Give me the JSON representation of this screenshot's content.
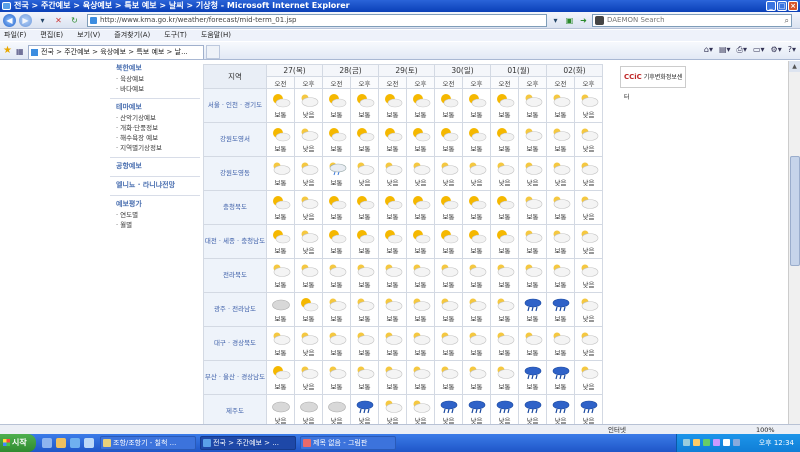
{
  "window": {
    "title": "전국 > 주간예보 > 육상예보 > 특보 예보 > 날씨 > 기상청 - Microsoft Internet Explorer"
  },
  "address": {
    "url": "http://www.kma.go.kr/weather/forecast/mid-term_01.jsp",
    "search_placeholder": "DAEMON Search"
  },
  "menu": [
    "파일(F)",
    "편집(E)",
    "보기(V)",
    "즐겨찾기(A)",
    "도구(T)",
    "도움말(H)"
  ],
  "tab": {
    "label": "전국 > 주간예보 > 육상예보 > 특보 예보 > 날..."
  },
  "sidebar": {
    "sections": [
      {
        "heading": "북한예보",
        "items": [
          "· 육상예보",
          "· 바다예보"
        ]
      },
      {
        "heading": "테마예보",
        "items": [
          "· 산악기상예보",
          "· 개화·단풍정보",
          "· 해수욕장 예보",
          "· 지역별기상정보"
        ]
      },
      {
        "heading": "공항예보",
        "items": []
      },
      {
        "heading": "엘니뇨 · 라니냐전망",
        "items": []
      },
      {
        "heading": "예보평가",
        "items": [
          "· 연도별",
          "· 월별"
        ]
      }
    ]
  },
  "forecast": {
    "region_header": "지역",
    "dates": [
      "27(목)",
      "28(금)",
      "29(토)",
      "30(일)",
      "01(월)",
      "02(화)"
    ],
    "am": "오전",
    "pm": "오후",
    "rows": [
      {
        "region": "서울 · 인천 · 경기도",
        "cells": [
          [
            "sun-cloud",
            "보통"
          ],
          [
            "cloud",
            "낮음"
          ],
          [
            "sun-cloud",
            "보통"
          ],
          [
            "sun-cloud",
            "보통"
          ],
          [
            "sun-cloud",
            "보통"
          ],
          [
            "sun-cloud",
            "보통"
          ],
          [
            "sun-cloud",
            "보통"
          ],
          [
            "sun-cloud",
            "보통"
          ],
          [
            "sun-cloud",
            "보통"
          ],
          [
            "cloud",
            "보통"
          ],
          [
            "cloud",
            "보통"
          ],
          [
            "cloud",
            "낮음"
          ]
        ]
      },
      {
        "region": "강원도영서",
        "cells": [
          [
            "sun-cloud",
            "보통"
          ],
          [
            "cloud",
            "낮음"
          ],
          [
            "sun-cloud",
            "보통"
          ],
          [
            "sun-cloud",
            "보통"
          ],
          [
            "sun-cloud",
            "보통"
          ],
          [
            "sun-cloud",
            "보통"
          ],
          [
            "sun-cloud",
            "보통"
          ],
          [
            "sun-cloud",
            "보통"
          ],
          [
            "sun-cloud",
            "보통"
          ],
          [
            "cloud",
            "보통"
          ],
          [
            "cloud",
            "보통"
          ],
          [
            "cloud",
            "낮음"
          ]
        ]
      },
      {
        "region": "강원도영동",
        "cells": [
          [
            "cloud",
            "보통"
          ],
          [
            "cloud",
            "낮음"
          ],
          [
            "rain-cloud",
            "보통"
          ],
          [
            "cloud",
            "낮음"
          ],
          [
            "cloud",
            "낮음"
          ],
          [
            "cloud",
            "낮음"
          ],
          [
            "cloud",
            "낮음"
          ],
          [
            "cloud",
            "낮음"
          ],
          [
            "cloud",
            "낮음"
          ],
          [
            "cloud",
            "낮음"
          ],
          [
            "cloud",
            "낮음"
          ],
          [
            "cloud",
            "낮음"
          ]
        ]
      },
      {
        "region": "충청북도",
        "cells": [
          [
            "sun-cloud",
            "보통"
          ],
          [
            "cloud",
            "낮음"
          ],
          [
            "sun-cloud",
            "보통"
          ],
          [
            "sun-cloud",
            "보통"
          ],
          [
            "sun-cloud",
            "보통"
          ],
          [
            "sun-cloud",
            "보통"
          ],
          [
            "sun-cloud",
            "보통"
          ],
          [
            "sun-cloud",
            "보통"
          ],
          [
            "sun-cloud",
            "보통"
          ],
          [
            "cloud",
            "보통"
          ],
          [
            "cloud",
            "보통"
          ],
          [
            "cloud",
            "낮음"
          ]
        ]
      },
      {
        "region": "대전 · 세종 · 충청남도",
        "cells": [
          [
            "sun-cloud",
            "보통"
          ],
          [
            "cloud",
            "낮음"
          ],
          [
            "sun-cloud",
            "보통"
          ],
          [
            "sun-cloud",
            "보통"
          ],
          [
            "sun-cloud",
            "보통"
          ],
          [
            "sun-cloud",
            "보통"
          ],
          [
            "sun-cloud",
            "보통"
          ],
          [
            "sun-cloud",
            "보통"
          ],
          [
            "sun-cloud",
            "보통"
          ],
          [
            "cloud",
            "보통"
          ],
          [
            "cloud",
            "보통"
          ],
          [
            "cloud",
            "낮음"
          ]
        ]
      },
      {
        "region": "전라북도",
        "cells": [
          [
            "cloud",
            "보통"
          ],
          [
            "cloud",
            "보통"
          ],
          [
            "cloud",
            "보통"
          ],
          [
            "cloud",
            "보통"
          ],
          [
            "cloud",
            "보통"
          ],
          [
            "cloud",
            "보통"
          ],
          [
            "cloud",
            "보통"
          ],
          [
            "cloud",
            "보통"
          ],
          [
            "cloud",
            "보통"
          ],
          [
            "cloud",
            "보통"
          ],
          [
            "cloud",
            "보통"
          ],
          [
            "cloud",
            "낮음"
          ]
        ]
      },
      {
        "region": "광주 · 전라남도",
        "cells": [
          [
            "cloud-grey",
            "보통"
          ],
          [
            "sun-cloud",
            "보통"
          ],
          [
            "cloud",
            "보통"
          ],
          [
            "cloud",
            "보통"
          ],
          [
            "cloud",
            "보통"
          ],
          [
            "cloud",
            "보통"
          ],
          [
            "cloud",
            "보통"
          ],
          [
            "cloud",
            "보통"
          ],
          [
            "cloud",
            "보통"
          ],
          [
            "rain",
            "보통"
          ],
          [
            "rain",
            "보통"
          ],
          [
            "cloud",
            "낮음"
          ]
        ]
      },
      {
        "region": "대구 · 경상북도",
        "cells": [
          [
            "cloud",
            "보통"
          ],
          [
            "cloud",
            "낮음"
          ],
          [
            "cloud",
            "보통"
          ],
          [
            "cloud",
            "보통"
          ],
          [
            "cloud",
            "보통"
          ],
          [
            "cloud",
            "보통"
          ],
          [
            "cloud",
            "보통"
          ],
          [
            "cloud",
            "보통"
          ],
          [
            "cloud",
            "보통"
          ],
          [
            "cloud",
            "보통"
          ],
          [
            "cloud",
            "보통"
          ],
          [
            "cloud",
            "낮음"
          ]
        ]
      },
      {
        "region": "부산 · 울산 · 경상남도",
        "cells": [
          [
            "sun-cloud",
            "보통"
          ],
          [
            "cloud",
            "낮음"
          ],
          [
            "cloud",
            "보통"
          ],
          [
            "cloud",
            "보통"
          ],
          [
            "cloud",
            "보통"
          ],
          [
            "cloud",
            "보통"
          ],
          [
            "cloud",
            "보통"
          ],
          [
            "cloud",
            "보통"
          ],
          [
            "cloud",
            "보통"
          ],
          [
            "rain",
            "보통"
          ],
          [
            "rain",
            "보통"
          ],
          [
            "cloud",
            "낮음"
          ]
        ]
      },
      {
        "region": "제주도",
        "cells": [
          [
            "cloud-grey",
            "낮음"
          ],
          [
            "cloud-grey",
            "낮음"
          ],
          [
            "cloud-grey",
            "낮음"
          ],
          [
            "rain",
            "낮음"
          ],
          [
            "cloud",
            "낮음"
          ],
          [
            "cloud",
            "낮음"
          ],
          [
            "rain",
            "낮음"
          ],
          [
            "rain",
            "낮음"
          ],
          [
            "rain",
            "낮음"
          ],
          [
            "rain",
            "낮음"
          ],
          [
            "rain",
            "낮음"
          ],
          [
            "rain",
            "낮음"
          ]
        ]
      }
    ]
  },
  "logo": {
    "text_red": "CCiC",
    "text": "기후변화정보센터"
  },
  "status": {
    "zone": "인터넷",
    "zoom": "100%"
  },
  "taskbar": {
    "start": "시작",
    "buttons": [
      "조항/조항기 - 칠척 ...",
      "전국 > 주간예보 > ...",
      "제목 없음 - 그림판"
    ],
    "clock": "오후 12:34"
  },
  "colors": {
    "title_bar": "#0a3fb7",
    "region_text": "#3b5da8",
    "taskbar": "#1f56c8"
  }
}
